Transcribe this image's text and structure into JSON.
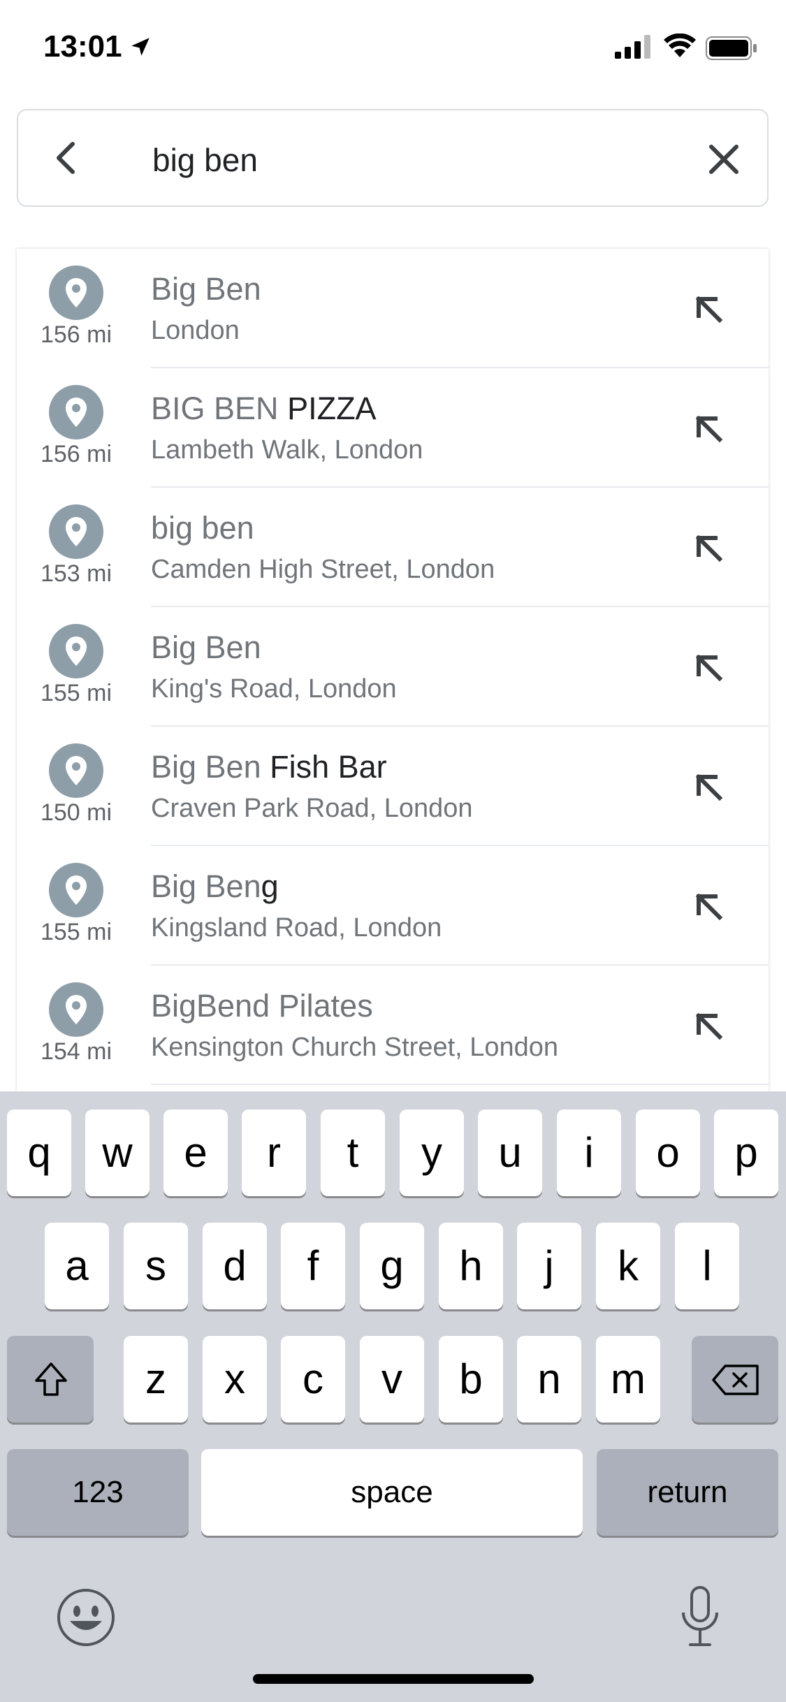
{
  "status_bar": {
    "time": "13:01"
  },
  "search": {
    "query": "big ben"
  },
  "results": [
    {
      "distance": "156 mi",
      "title_plain": "Big Ben",
      "title_em": "",
      "subtitle": "London"
    },
    {
      "distance": "156 mi",
      "title_plain": "BIG BEN ",
      "title_em": "PIZZA",
      "subtitle": "Lambeth Walk, London"
    },
    {
      "distance": "153 mi",
      "title_plain": "big ben",
      "title_em": "",
      "subtitle": "Camden High Street, London"
    },
    {
      "distance": "155 mi",
      "title_plain": "Big Ben",
      "title_em": "",
      "subtitle": "King's Road, London"
    },
    {
      "distance": "150 mi",
      "title_plain": "Big Ben ",
      "title_em": "Fish Bar",
      "subtitle": "Craven Park Road, London"
    },
    {
      "distance": "155 mi",
      "title_plain": "Big Ben",
      "title_em": "g",
      "subtitle": "Kingsland Road, London"
    },
    {
      "distance": "154 mi",
      "title_plain": "BigBend Pilates",
      "title_em": "",
      "subtitle": "Kensington Church Street, London"
    }
  ],
  "keyboard": {
    "row1": [
      "q",
      "w",
      "e",
      "r",
      "t",
      "y",
      "u",
      "i",
      "o",
      "p"
    ],
    "row2": [
      "a",
      "s",
      "d",
      "f",
      "g",
      "h",
      "j",
      "k",
      "l"
    ],
    "row3": [
      "z",
      "x",
      "c",
      "v",
      "b",
      "n",
      "m"
    ],
    "numbers_label": "123",
    "space_label": "space",
    "return_label": "return"
  }
}
